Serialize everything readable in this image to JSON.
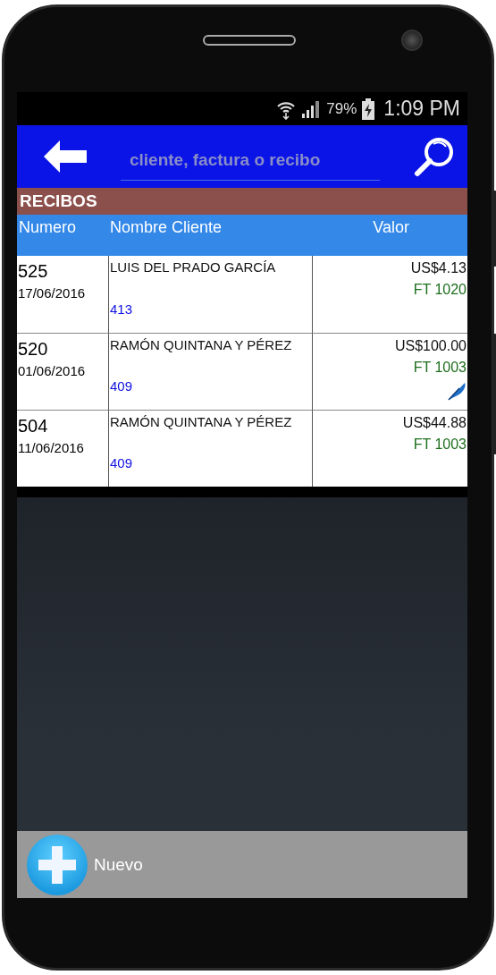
{
  "status_bar": {
    "battery": "79%",
    "time": "1:09 PM"
  },
  "header": {
    "search": {
      "placeholder": "cliente, factura o recibo"
    }
  },
  "section_title": "RECIBOS",
  "table": {
    "columns": [
      "Numero",
      "Nombre Cliente",
      "Valor"
    ],
    "rows": [
      {
        "number": "525",
        "date": "17/06/2016",
        "client": "LUIS DEL PRADO GARCÍA",
        "client_code": "413",
        "amount": "US$4.13",
        "invoice": "FT 1020",
        "signed": false
      },
      {
        "number": "520",
        "date": "01/06/2016",
        "client": "RAMÓN QUINTANA Y PÉREZ",
        "client_code": "409",
        "amount": "US$100.00",
        "invoice": "FT 1003",
        "signed": true
      },
      {
        "number": "504",
        "date": "11/06/2016",
        "client": "RAMÓN QUINTANA Y PÉREZ",
        "client_code": "409",
        "amount": "US$44.88",
        "invoice": "FT 1003",
        "signed": false
      }
    ]
  },
  "footer": {
    "button": "Nuevo"
  }
}
